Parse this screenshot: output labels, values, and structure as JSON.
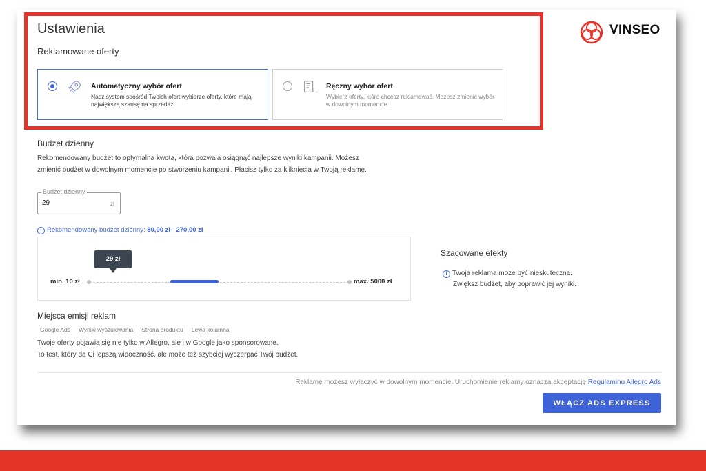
{
  "header": {
    "title": "Ustawienia",
    "subtitle": "Reklamowane oferty"
  },
  "brand": {
    "name": "VINSEO",
    "accent": "#e5332a"
  },
  "offer_options": [
    {
      "title": "Automatyczny wybór ofert",
      "description": "Nasz system spośród Twoich ofert wybierze oferty, które mają największą szansę na sprzedaż.",
      "selected": true,
      "icon": "rocket-icon"
    },
    {
      "title": "Ręczny wybór ofert",
      "description": "Wybierz oferty, które chcesz reklamować. Możesz zmienić wybór w dowolnym momencie.",
      "selected": false,
      "icon": "list-add-icon"
    }
  ],
  "budget": {
    "title": "Budżet dzienny",
    "description_line1": "Rekomendowany budżet to optymalna kwota, która pozwala osiągnąć najlepsze wyniki kampanii. Możesz",
    "description_line2": "zmienić budżet w dowolnym momencie po stworzeniu kampanii. Płacisz tylko za kliknięcia w Twoją reklamę.",
    "field_label": "Budżet dzienny",
    "field_value": "29",
    "field_unit": "zł",
    "recommended_label": "Rekomendowany budżet dzienny:",
    "recommended_range": "80,00 zł - 270,00 zł"
  },
  "slider": {
    "tooltip": "29 zł",
    "min_label": "min. 10 zł",
    "max_label": "max. 5000 zł",
    "value": 29,
    "recommended_min": 80,
    "recommended_max": 270
  },
  "effects": {
    "title": "Szacowane efekty",
    "line1": "Twoja reklama może być nieskuteczna.",
    "line2": "Zwiększ budżet, aby poprawić jej wyniki."
  },
  "placements": {
    "title": "Miejsca emisji reklam",
    "chips": [
      "Google Ads",
      "Wyniki wyszukiwania",
      "Strona produktu",
      "Lewa kolumna"
    ],
    "line1": "Twoje oferty pojawią się nie tylko w Allegro, ale i w Google jako sponsorowane.",
    "line2": "To test, który da Ci lepszą widoczność, ale może też szybciej wyczerpać Twój budżet."
  },
  "footer": {
    "note": "Reklamę możesz wyłączyć w dowolnym momencie. Uruchomienie reklamy oznacza akceptację",
    "link": "Regulaminu Allegro Ads",
    "cta": "WŁĄCZ ADS EXPRESS"
  },
  "colors": {
    "primary": "#3e63d8",
    "highlight_border": "#e5332a",
    "tooltip_bg": "#3c4650"
  }
}
